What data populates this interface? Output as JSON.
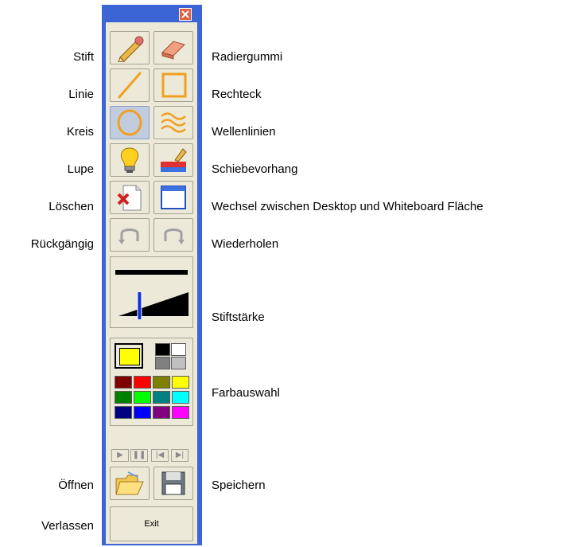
{
  "labels_left": {
    "stift": "Stift",
    "linie": "Linie",
    "kreis": "Kreis",
    "lupe": "Lupe",
    "loeschen": "Löschen",
    "rueckgaengig": "Rückgängig",
    "oeffnen": "Öffnen",
    "verlassen": "Verlassen"
  },
  "labels_right": {
    "radiergummi": "Radiergummi",
    "rechteck": "Rechteck",
    "wellenlinien": "Wellenlinien",
    "schiebevorhang": "Schiebevorhang",
    "wechsel": "Wechsel zwischen Desktop und Whiteboard Fläche",
    "wiederholen": "Wiederholen",
    "stiftstaerke": "Stiftstärke",
    "farbauswahl": "Farbauswahl",
    "speichern": "Speichern"
  },
  "toolbar": {
    "exit_label": "Exit",
    "close_glyph": "✕",
    "active_tool": "circle",
    "playback": [
      "▶",
      "❚❚",
      "|◀",
      "▶|"
    ]
  },
  "pen_width": {
    "level": 0.3
  },
  "colors": {
    "toolbar_frame": "#3b64d4",
    "selected_foreground": "#ffff00",
    "grid": [
      "#800000",
      "#ff0000",
      "#808000",
      "#ffff00",
      "#008000",
      "#00ff00",
      "#008080",
      "#00ffff",
      "#000080",
      "#0000ff",
      "#800080",
      "#ff00ff"
    ],
    "top_right": [
      "#000000",
      "#ffffff",
      "#808080",
      "#c0c0c0"
    ]
  }
}
